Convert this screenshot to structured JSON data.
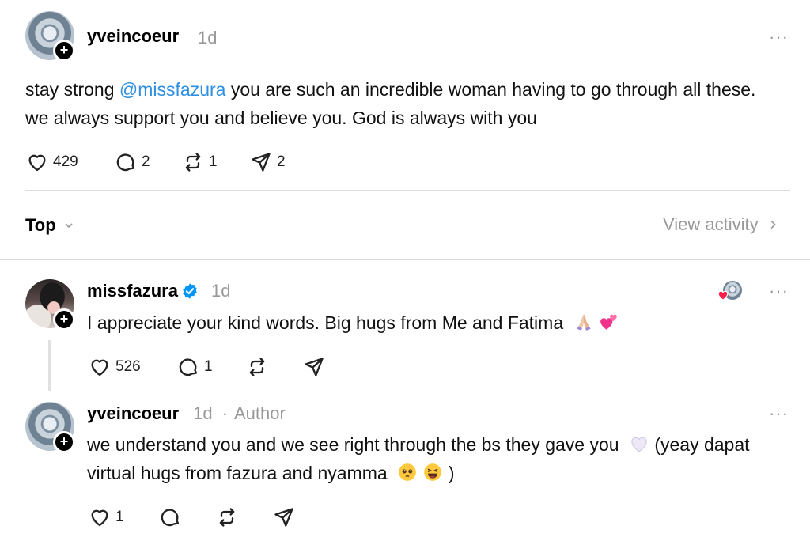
{
  "post": {
    "username": "yveincoeur",
    "time": "1d",
    "more": "···",
    "text_before": "stay strong ",
    "mention": "@missfazura",
    "text_after": " you are such an incredible woman having to go through all these. we always support you and believe you. God is always with you",
    "likes": "429",
    "replies": "2",
    "reposts": "1",
    "shares": "2"
  },
  "sort": {
    "label": "Top",
    "view_activity": "View activity"
  },
  "replies": [
    {
      "username": "missfazura",
      "time": "1d",
      "more": "···",
      "text": "I appreciate your kind words. Big hugs from Me and Fatima",
      "likes": "526",
      "replies": "1"
    },
    {
      "username": "yveincoeur",
      "time": "1d",
      "author_sep": "·",
      "author": "Author",
      "more": "···",
      "text_1": "we understand you and we see right through the bs they gave you",
      "text_2": " (yeay dapat virtual hugs from fazura and nyamma",
      "text_3": " )",
      "likes": "1"
    }
  ],
  "colors": {
    "mention": "#2f8fe0",
    "verified": "#0095f6",
    "muted": "#999999"
  },
  "icons": [
    "heart-icon",
    "comment-icon",
    "repost-icon",
    "share-icon",
    "plus-icon",
    "verified-icon",
    "chevron-down-icon",
    "chevron-right-icon",
    "more-icon"
  ]
}
